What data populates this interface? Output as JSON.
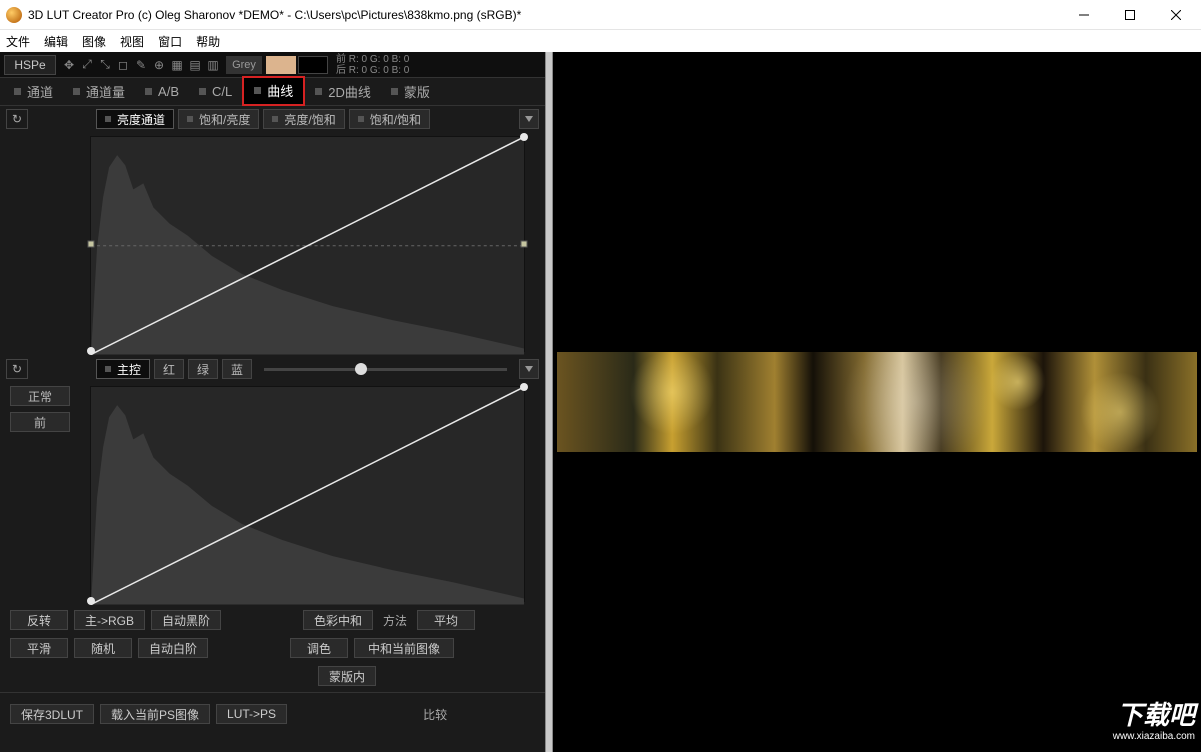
{
  "window": {
    "title": "3D LUT Creator Pro (c) Oleg Sharonov *DEMO* - C:\\Users\\pc\\Pictures\\838kmo.png (sRGB)*"
  },
  "menu": {
    "file": "文件",
    "edit": "编辑",
    "image": "图像",
    "view": "视图",
    "window": "窗口",
    "help": "帮助"
  },
  "toolbar": {
    "colormodel": "HSPe",
    "grey": "Grey",
    "readout_front": "前  R:    0    G:    0    B:    0",
    "readout_back": "后  R:    0    G:    0    B:    0"
  },
  "tabs": {
    "channel": "通道",
    "channel_qty": "通道量",
    "ab": "A/B",
    "cl": "C/L",
    "curves": "曲线",
    "curves2d": "2D曲线",
    "mask": "蒙版"
  },
  "subtabs1": {
    "lum": "亮度通道",
    "sathue": "饱和/亮度",
    "lumsat": "亮度/饱和",
    "satsat": "饱和/饱和"
  },
  "subtabs2": {
    "master": "主控",
    "red": "红",
    "green": "绿",
    "blue": "蓝"
  },
  "side": {
    "mode": "正常",
    "front": "前"
  },
  "bottom": {
    "invert": "反转",
    "torgb": "主->RGB",
    "autoblack": "自动黑阶",
    "smooth": "平滑",
    "random": "随机",
    "autowhite": "自动白阶",
    "colorneutral": "色彩中和",
    "method_label": "方法",
    "method": "平均",
    "tone": "调色",
    "matchcurrent": "中和当前图像",
    "inmask": "蒙版内",
    "savelut": "保存3DLUT",
    "loadps": "载入当前PS图像",
    "luttops": "LUT->PS",
    "compare": "比较"
  },
  "watermark": {
    "brand": "下载吧",
    "url": "www.xiazaiba.com"
  }
}
